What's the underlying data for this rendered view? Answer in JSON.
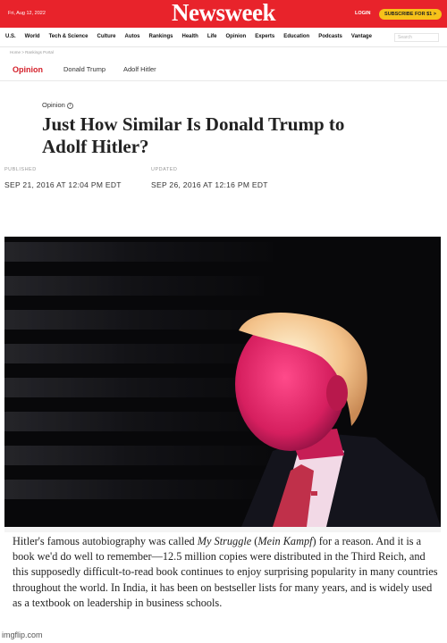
{
  "header": {
    "date": "Fri, Aug 12, 2022",
    "logo": "Newsweek",
    "login": "LOGIN",
    "subscribe": "SUBSCRIBE FOR $1 >",
    "colors": {
      "brand_red": "#e8232b",
      "subscribe_yellow": "#f6c21a"
    }
  },
  "nav": {
    "items": [
      "U.S.",
      "World",
      "Tech & Science",
      "Culture",
      "Autos",
      "Rankings",
      "Health",
      "Life",
      "Opinion",
      "Experts",
      "Education",
      "Podcasts",
      "Vantage"
    ],
    "search_placeholder": "Search"
  },
  "breadcrumb": "Home > Rankings Portal",
  "subnav": {
    "section": "Opinion",
    "tags": [
      "Donald Trump",
      "Adolf Hitler"
    ]
  },
  "article": {
    "kicker": "Opinion",
    "info_icon": "info-icon",
    "headline_line1": "Just How Similar Is Donald Trump to",
    "headline_line2": "Adolf Hitler?",
    "published_label": "PUBLISHED",
    "published_value": "SEP 21, 2016 AT 12:04 PM EDT",
    "updated_label": "UPDATED",
    "updated_value": "SEP 26, 2016 AT 12:16 PM EDT",
    "body": {
      "p1": "Hitler's famous autobiography was called ",
      "p2": "My Struggle",
      "p3": " (",
      "p4": "Mein Kampf",
      "p5": ") for a reason. And it is a book we'd do well to remember—12.5 million copies were distributed in the Third Reich, and this supposedly difficult-to-read book continues to enjoy surprising popularity in many countries throughout the world. In India, it has been on bestseller lists for many years, and is widely used as a textbook on leadership in business schools."
    }
  },
  "watermark": "imgflip.com"
}
